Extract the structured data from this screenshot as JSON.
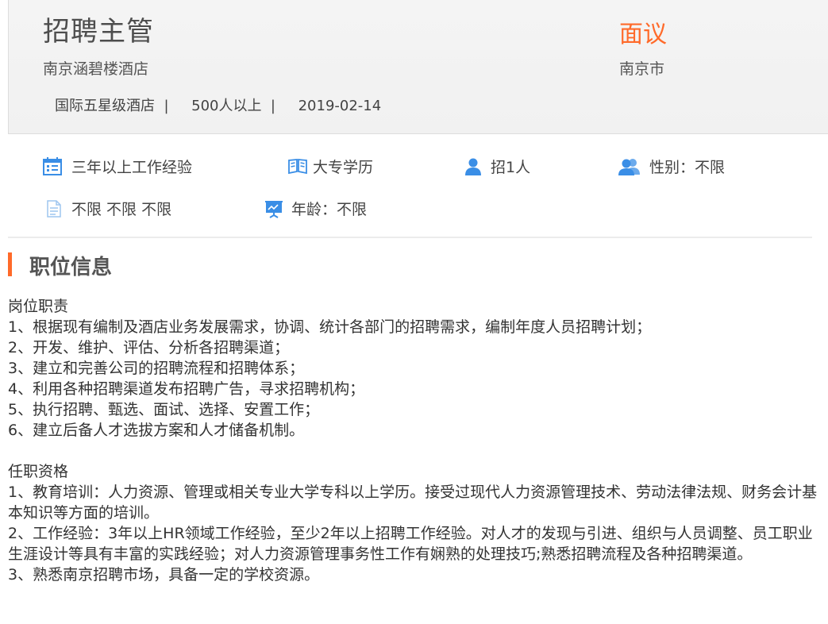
{
  "job": {
    "title": "招聘主管",
    "company": "南京涵碧楼酒店",
    "meta": "国际五星级酒店  |     500人以上  |     2019-02-14",
    "salary": "面议",
    "city": "南京市"
  },
  "features": {
    "experience": "三年以上工作经验",
    "education": "大专学历",
    "headcount": "招1人",
    "gender": "性别：不限",
    "language": "不限 不限 不限",
    "age": "年龄：不限"
  },
  "section": {
    "title": "职位信息"
  },
  "description": {
    "duties_heading": "岗位职责",
    "duties": [
      "1、根据现有编制及酒店业务发展需求，协调、统计各部门的招聘需求，编制年度人员招聘计划；",
      "2、开发、维护、评估、分析各招聘渠道；",
      "3、建立和完善公司的招聘流程和招聘体系；",
      "4、利用各种招聘渠道发布招聘广告，寻求招聘机构；",
      "5、执行招聘、甄选、面试、选择、安置工作；",
      "6、建立后备人才选拔方案和人才储备机制。"
    ],
    "req_heading": "任职资格",
    "requirements": [
      "1、教育培训：人力资源、管理或相关专业大学专科以上学历。接受过现代人力资源管理技术、劳动法律法规、财务会计基本知识等方面的培训。",
      "2、工作经验：3年以上HR领域工作经验，至少2年以上招聘工作经验。对人才的发现与引进、组织与人员调整、员工职业生涯设计等具有丰富的实践经验；对人力资源管理事务性工作有娴熟的处理技巧;熟悉招聘流程及各种招聘渠道。",
      "3、熟悉南京招聘市场，具备一定的学校资源。"
    ]
  },
  "colors": {
    "accent": "#ff6a2a",
    "icon": "#3a8ee6"
  }
}
